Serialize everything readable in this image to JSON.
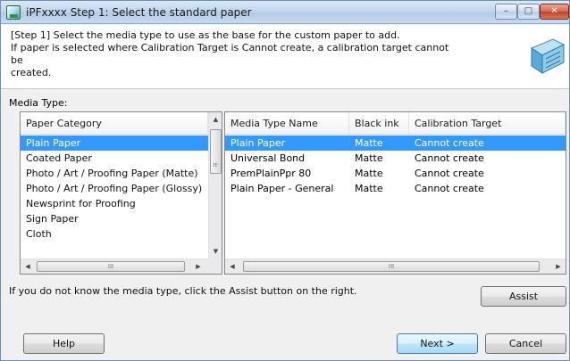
{
  "window": {
    "title": "iPFxxxx Step 1: Select the standard paper",
    "controls": {
      "minimize": "–",
      "maximize": "□",
      "close": "✕"
    }
  },
  "header": {
    "lines": [
      "[Step 1] Select the media type to use as the base for the custom paper to add.",
      "If paper is selected where Calibration Target is Cannot create, a calibration target cannot be",
      "created."
    ]
  },
  "media_type_label": "Media Type:",
  "category_list": {
    "header": "Paper Category",
    "items": [
      "Plain Paper",
      "Coated Paper",
      "Photo / Art / Proofing Paper (Matte)",
      "Photo / Art / Proofing Paper (Glossy)",
      "Newsprint for Proofing",
      "Sign Paper",
      "Cloth"
    ],
    "selected_index": 0
  },
  "media_table": {
    "columns": [
      "Media Type Name",
      "Black ink",
      "Calibration Target"
    ],
    "rows": [
      [
        "Plain Paper",
        "Matte",
        "Cannot create"
      ],
      [
        "Universal Bond",
        "Matte",
        "Cannot create"
      ],
      [
        "PremPlainPpr 80",
        "Matte",
        "Cannot create"
      ],
      [
        "Plain Paper - General",
        "Matte",
        "Cannot create"
      ]
    ],
    "selected_index": 0
  },
  "scroll_glyphs": {
    "up": "▲",
    "down": "▼",
    "left": "◀",
    "right": "▶",
    "grip": "III",
    "vgrip": "≡"
  },
  "assist_note": "If you do not know the media type, click the Assist button on the right.",
  "buttons": {
    "assist": "Assist",
    "help": "Help",
    "next": "Next >",
    "cancel": "Cancel"
  },
  "colors": {
    "selection": "#3399ff",
    "title_gradient": "#c2d6ee",
    "close_button": "#c2412a"
  }
}
